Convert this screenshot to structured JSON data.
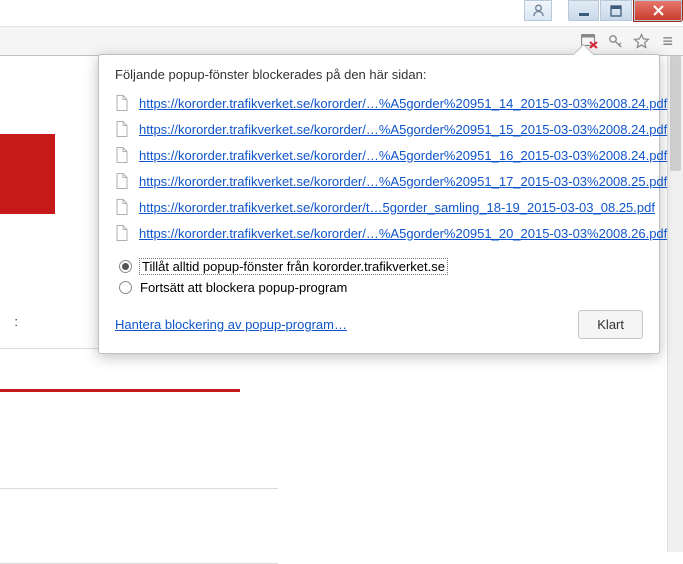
{
  "window_controls": {
    "minimize": "minimize",
    "maximize": "maximize",
    "close": "close",
    "user": "user"
  },
  "address_icons": {
    "popup_blocked": "popup-blocked",
    "key": "key",
    "star": "star",
    "menu": "menu"
  },
  "popup": {
    "header": "Följande popup-fönster blockerades på den här sidan:",
    "links": [
      "https://kororder.trafikverket.se/kororder/…%A5gorder%20951_14_2015-03-03%2008.24.pdf",
      "https://kororder.trafikverket.se/kororder/…%A5gorder%20951_15_2015-03-03%2008.24.pdf",
      "https://kororder.trafikverket.se/kororder/…%A5gorder%20951_16_2015-03-03%2008.24.pdf",
      "https://kororder.trafikverket.se/kororder/…%A5gorder%20951_17_2015-03-03%2008.25.pdf",
      "https://kororder.trafikverket.se/kororder/t…5gorder_samling_18-19_2015-03-03_08.25.pdf",
      "https://kororder.trafikverket.se/kororder/…%A5gorder%20951_20_2015-03-03%2008.26.pdf"
    ],
    "radio_allow": "Tillåt alltid popup-fönster från kororder.trafikverket.se",
    "radio_block": "Fortsätt att blockera popup-program",
    "manage_link": "Hantera blockering av popup-program…",
    "done_button": "Klart"
  },
  "left_label": ":"
}
